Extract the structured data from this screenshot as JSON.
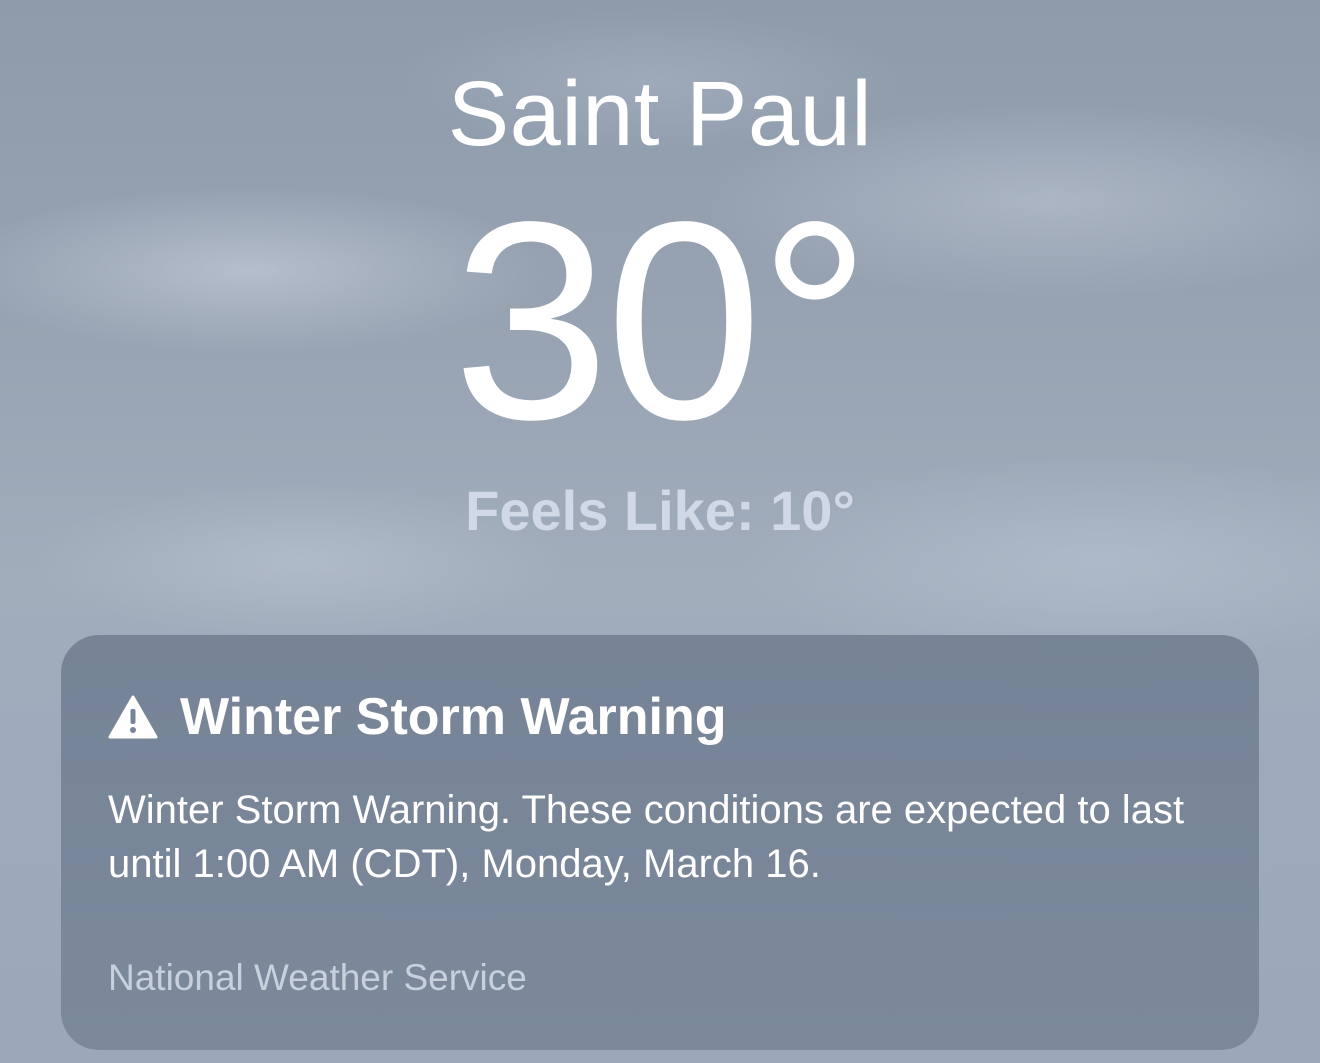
{
  "location": {
    "city": "Saint Paul",
    "temperature": "30°",
    "feels_like": "Feels Like: 10°"
  },
  "alert": {
    "icon": "warning-triangle-icon",
    "title": "Winter Storm Warning",
    "body": "Winter Storm Warning. These conditions are expected to last until 1:00 AM (CDT), Monday, March 16.",
    "source": "National Weather Service"
  },
  "colors": {
    "text_primary": "#ffffff",
    "text_secondary": "#d0d9e5",
    "card_background": "#76849a"
  }
}
